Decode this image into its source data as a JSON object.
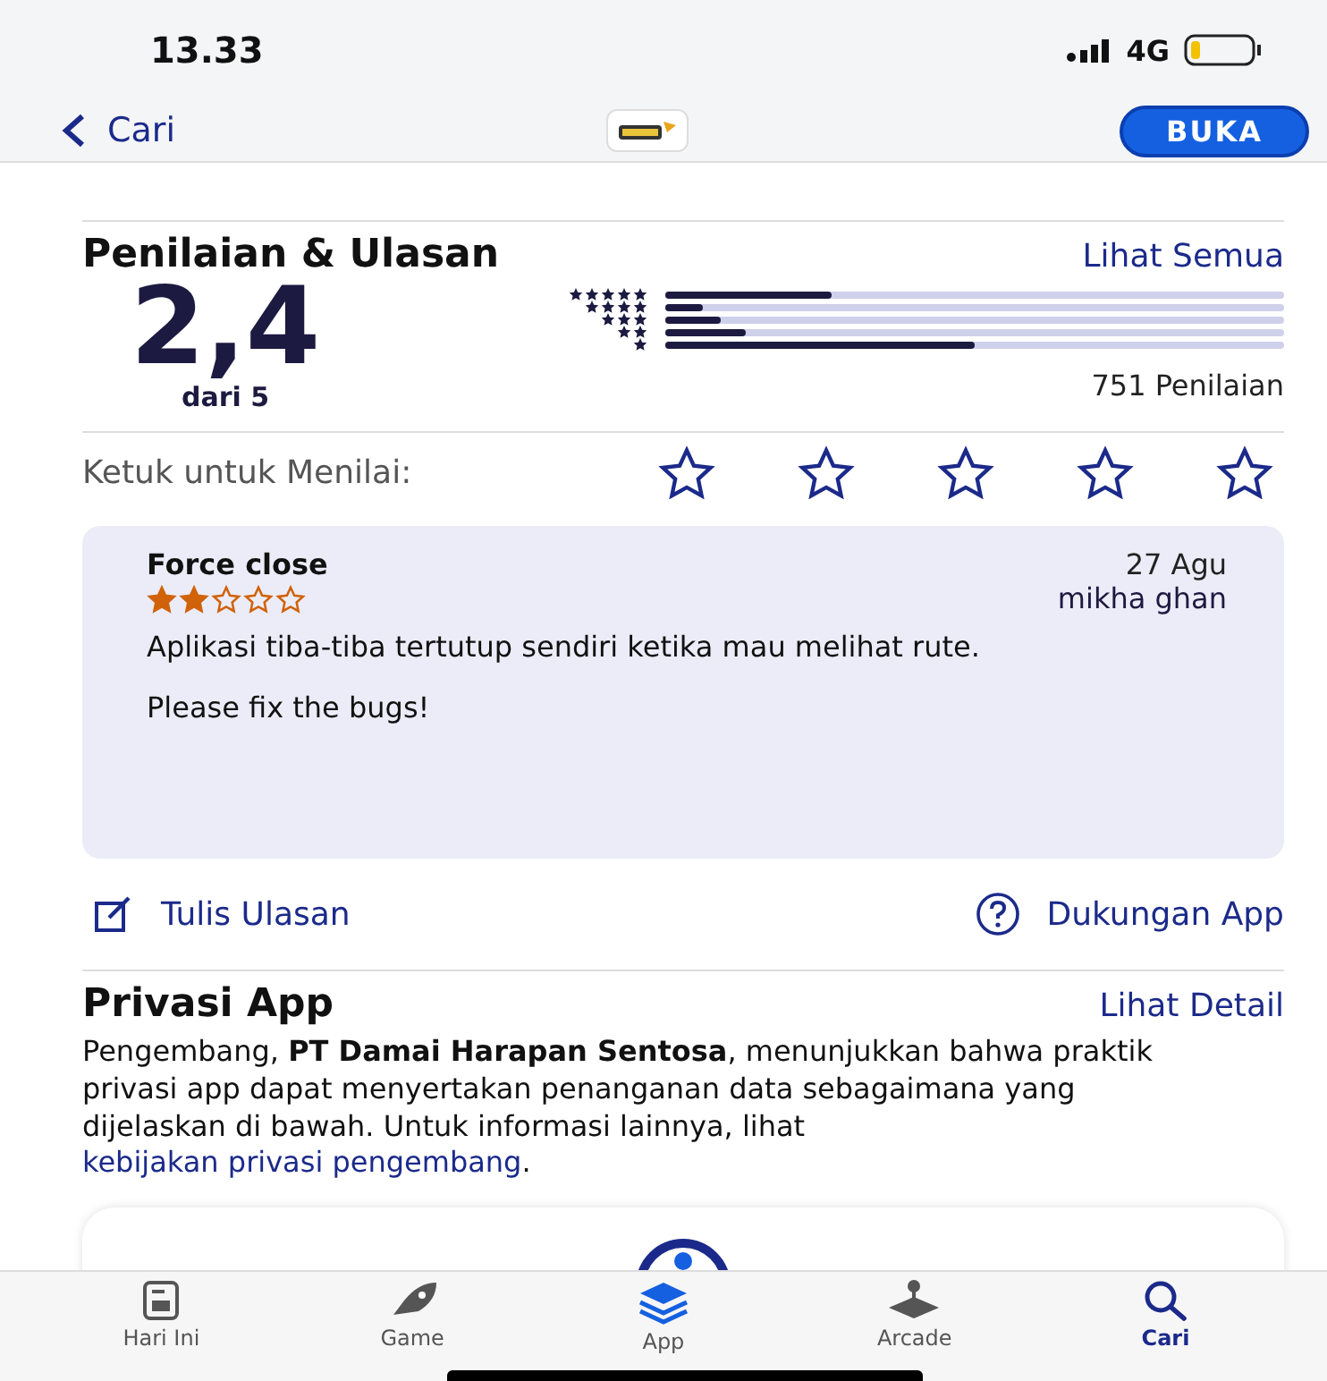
{
  "status_bar": {
    "time": "13.33",
    "network": "4G"
  },
  "nav": {
    "back_label": "Cari",
    "open_button": "BUKA"
  },
  "ratings": {
    "title": "Penilaian & Ulasan",
    "see_all": "Lihat Semua",
    "score": "2,4",
    "out_of": "dari 5",
    "count": "751 Penilaian",
    "histogram": [
      {
        "level": 0.27
      },
      {
        "level": 0.06
      },
      {
        "level": 0.09
      },
      {
        "level": 0.13
      },
      {
        "level": 0.5
      }
    ]
  },
  "tap_to_rate": {
    "label": "Ketuk untuk Menilai:",
    "stars": 0
  },
  "review": {
    "title": "Force close",
    "date": "27 Agu",
    "author": "mikha ghan",
    "stars": 2,
    "paragraphs": [
      "Aplikasi tiba-tiba tertutup sendiri ketika mau melihat rute.",
      "Please fix the bugs!"
    ]
  },
  "actions": [
    {
      "label": "Tulis Ulasan",
      "kind": "write"
    },
    {
      "label": "Dukungan App",
      "kind": "support"
    }
  ],
  "privacy": {
    "title": "Privasi App",
    "see_detail": "Lihat Detail",
    "text": "Pengembang, **PT Damai Harapan Sentosa**, menunjukkan bahwa praktik privasi app dapat menyertakan penanganan data sebagaimana yang dijelaskan di bawah. Untuk informasi lainnya, lihat",
    "link": "kebijakan privasi pengembang",
    "after": "."
  },
  "tab_bar": [
    {
      "label": "Hari Ini",
      "kind": "today",
      "selected": false
    },
    {
      "label": "Game",
      "kind": "games",
      "selected": false
    },
    {
      "label": "App",
      "kind": "apps",
      "selected": false
    },
    {
      "label": "Arcade",
      "kind": "arcade",
      "selected": false
    },
    {
      "label": "Cari",
      "kind": "search",
      "selected": true
    }
  ]
}
